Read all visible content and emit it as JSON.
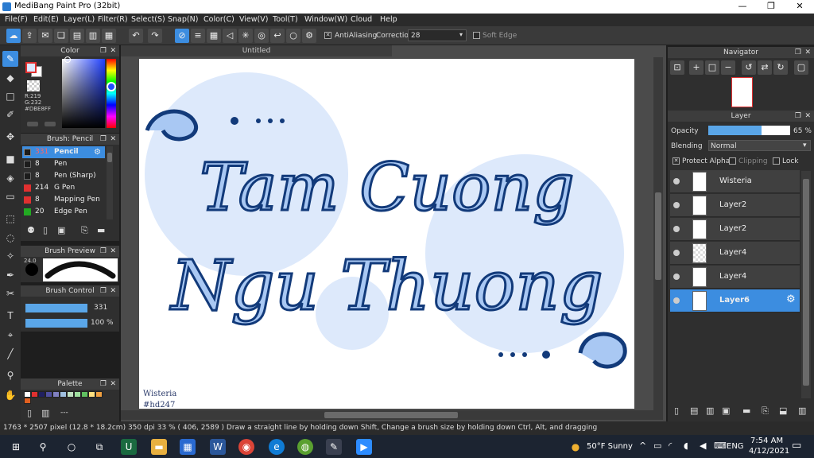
{
  "window": {
    "title": "MediBang Paint Pro (32bit)",
    "minimize": "—",
    "maximize": "❐",
    "close": "✕"
  },
  "menu": [
    "File(F)",
    "Edit(E)",
    "Layer(L)",
    "Filter(R)",
    "Select(S)",
    "Snap(N)",
    "Color(C)",
    "View(V)",
    "Tool(T)",
    "Window(W)",
    "Cloud",
    "Help"
  ],
  "toolbar": {
    "antialiasing_label": "AntiAliasing",
    "correction_label": "Correction",
    "correction_value": "28",
    "soft_edge_label": "Soft Edge"
  },
  "color_panel": {
    "title": "Color",
    "r": "R:219",
    "g": "G:232",
    "hex": "#DBE8FF",
    "fg_color": "#DBE8FF",
    "bg_color": "#FFFFFF"
  },
  "brush_panel": {
    "title": "Brush: Pencil",
    "items": [
      {
        "size": "331",
        "name": "Pencil",
        "color": "#1c1c1c"
      },
      {
        "size": "8",
        "name": "Pen",
        "color": "#1c1c1c"
      },
      {
        "size": "8",
        "name": "Pen (Sharp)",
        "color": "#1c1c1c"
      },
      {
        "size": "214",
        "name": "G Pen",
        "color": "#e03030"
      },
      {
        "size": "8",
        "name": "Mapping Pen",
        "color": "#e03030"
      },
      {
        "size": "20",
        "name": "Edge Pen",
        "color": "#22aa22"
      }
    ]
  },
  "brush_preview": {
    "title": "Brush Preview",
    "size_label": "24.0"
  },
  "brush_control": {
    "title": "Brush Control",
    "size": "331",
    "opacity": "100 %",
    "size_fraction": 0.33,
    "opacity_fraction": 1.0
  },
  "palette": {
    "title": "Palette",
    "dash": "---",
    "colors": [
      "#ffffff",
      "#e03030",
      "#202060",
      "#5050a0",
      "#8080c0",
      "#a0c0e0",
      "#c0e0c0",
      "#a0e0a0",
      "#60c060",
      "#ffe080",
      "#f0a040",
      "#e06020"
    ]
  },
  "canvas": {
    "tab": "Untitled",
    "line1": "Tam Cuong",
    "line2": "Ngu Thuong",
    "signature": "Wisteria",
    "handle": "#hd247"
  },
  "navigator": {
    "title": "Navigator"
  },
  "layer_panel": {
    "title": "Layer",
    "opacity_label": "Opacity",
    "opacity_value": "65 %",
    "opacity_fraction": 0.65,
    "blending_label": "Blending",
    "blending_value": "Normal",
    "protect_alpha": "Protect Alpha",
    "clipping": "Clipping",
    "lock": "Lock",
    "layers": [
      {
        "name": "Wisteria"
      },
      {
        "name": "Layer2"
      },
      {
        "name": "Layer2"
      },
      {
        "name": "Layer4"
      },
      {
        "name": "Layer4"
      },
      {
        "name": "Layer6"
      }
    ]
  },
  "status": "1763 * 2507 pixel  (12.8 * 18.2cm)  350 dpi   33 %   ( 406, 2589 )   Draw a straight line by holding down Shift, Change a brush size by holding down Ctrl, Alt, and dragging",
  "taskbar": {
    "weather": "50°F  Sunny",
    "lang": "ENG",
    "time": "7:54 AM",
    "date": "4/12/2021"
  }
}
